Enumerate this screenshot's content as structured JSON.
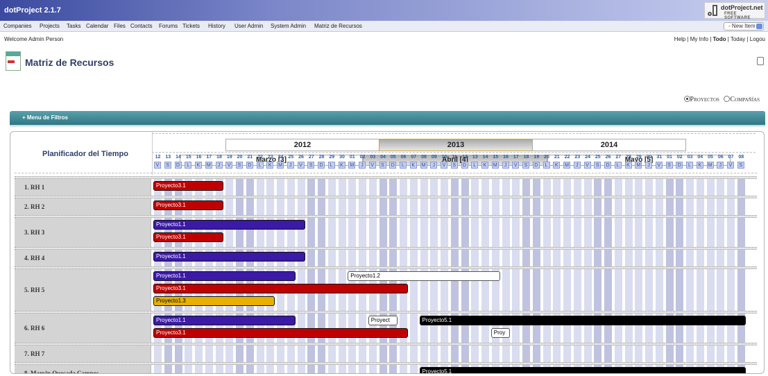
{
  "app": {
    "title": "dotProject 2.1.7"
  },
  "logo": {
    "line1": "dotProject.net",
    "line2": "FREE SOFTWARE"
  },
  "nav": {
    "items": [
      "Companies",
      "Projects",
      "Tasks",
      "Calendar",
      "Files",
      "Contacts",
      "Forums",
      "Tickets",
      "History",
      "User Admin",
      "System Admin",
      "Matriz de Recursos"
    ]
  },
  "new_item": {
    "label": "- New Item -"
  },
  "welcome": "Welcome Admin Person",
  "top_links": {
    "help": "Help",
    "my_info": "My Info",
    "todo": "Todo",
    "today": "Today",
    "logout": "Logou"
  },
  "page": {
    "title": "Matriz de Recursos"
  },
  "view_options": {
    "selected": "Proyectos",
    "proyectos": "Proyectos",
    "companias": "Compañías"
  },
  "filter_menu": {
    "label": "+ Menu de Filtros"
  },
  "planner": {
    "title": "Planificador del Tiempo",
    "years": [
      {
        "label": "2012",
        "active": false
      },
      {
        "label": "2013",
        "active": true
      },
      {
        "label": "2014",
        "active": false
      }
    ],
    "months": [
      {
        "label": "Marzo [3]",
        "active": false
      },
      {
        "label": "Abril [4]",
        "active": true
      },
      {
        "label": "Mayo [5]",
        "active": false
      }
    ],
    "day_numbers": [
      "12",
      "13",
      "14",
      "15",
      "16",
      "17",
      "18",
      "19",
      "20",
      "21",
      "22",
      "23",
      "24",
      "25",
      "26",
      "27",
      "28",
      "29",
      "30",
      "01",
      "02",
      "03",
      "04",
      "05",
      "06",
      "07",
      "08",
      "09",
      "10",
      "11",
      "12",
      "13",
      "14",
      "15",
      "16",
      "17",
      "18",
      "19",
      "20",
      "21",
      "22",
      "23",
      "24",
      "25",
      "26",
      "27",
      "28",
      "29",
      "30",
      "31",
      "01",
      "02",
      "03",
      "04",
      "05",
      "06",
      "07",
      "08"
    ],
    "day_letters": [
      "V",
      "S",
      "D",
      "L",
      "K",
      "M",
      "J",
      "V",
      "S",
      "D",
      "L",
      "K",
      "M",
      "J",
      "V",
      "S",
      "D",
      "L",
      "K",
      "M",
      "J",
      "V",
      "S",
      "D",
      "L",
      "K",
      "M",
      "J",
      "V",
      "S",
      "D",
      "L",
      "K",
      "M",
      "J",
      "V",
      "S",
      "D",
      "L",
      "K",
      "M",
      "J",
      "V",
      "S",
      "D",
      "L",
      "K",
      "M",
      "J",
      "V",
      "S",
      "D",
      "L",
      "K",
      "M",
      "J",
      "V",
      "S"
    ],
    "resources": [
      {
        "label": "1. RH 1",
        "tasks": [
          {
            "name": "Proyecto3.1",
            "color": "#c00000",
            "start": 0,
            "days": 7,
            "lane": 0
          }
        ]
      },
      {
        "label": "2. RH 2",
        "tasks": [
          {
            "name": "Proyecto3.1",
            "color": "#c00000",
            "start": 0,
            "days": 7,
            "lane": 0
          }
        ]
      },
      {
        "label": "3. RH 3",
        "tasks": [
          {
            "name": "Proyecto1.1",
            "color": "#3a1aa6",
            "start": 0,
            "days": 15,
            "lane": 0
          },
          {
            "name": "Proyecto3.1",
            "color": "#c00000",
            "start": 0,
            "days": 7,
            "lane": 1
          }
        ]
      },
      {
        "label": "4. RH 4",
        "tasks": [
          {
            "name": "Proyecto1.1",
            "color": "#3a1aa6",
            "start": 0,
            "days": 15,
            "lane": 0
          }
        ]
      },
      {
        "label": "5. RH 5",
        "tasks": [
          {
            "name": "Proyecto1.1",
            "color": "#3a1aa6",
            "start": 0,
            "days": 14,
            "lane": 0
          },
          {
            "name": "Proyecto1.2",
            "color": "#ffffff",
            "start": 19,
            "days": 15,
            "lane": 0
          },
          {
            "name": "Proyecto3.1",
            "color": "#c00000",
            "start": 0,
            "days": 25,
            "lane": 1
          },
          {
            "name": "Proyecto1.3",
            "color": "#e8b000",
            "start": 0,
            "days": 12,
            "lane": 2
          }
        ]
      },
      {
        "label": "6. RH 6",
        "tasks": [
          {
            "name": "Proyecto1.1",
            "color": "#3a1aa6",
            "start": 0,
            "days": 14,
            "lane": 0
          },
          {
            "name": "Proyect",
            "color": "#ffffff",
            "start": 21,
            "days": 3,
            "lane": 0
          },
          {
            "name": "Proyecto5.1",
            "color": "#000000",
            "start": 26,
            "days": 32,
            "lane": 0
          },
          {
            "name": "Proyecto3.1",
            "color": "#c00000",
            "start": 0,
            "days": 25,
            "lane": 1
          },
          {
            "name": "Proy",
            "color": "#ffffff",
            "start": 33,
            "days": 2,
            "lane": 1
          }
        ]
      },
      {
        "label": "7. RH 7",
        "tasks": []
      },
      {
        "label": "8. Marvin Quesada Campos",
        "tasks": [
          {
            "name": "Proyecto5.1",
            "color": "#000000",
            "start": 26,
            "days": 32,
            "lane": 0
          }
        ]
      }
    ]
  },
  "colors": {
    "accent": "#2f7784",
    "weekend_col": "#bfc3df",
    "weekday_col": "#dadcef"
  }
}
